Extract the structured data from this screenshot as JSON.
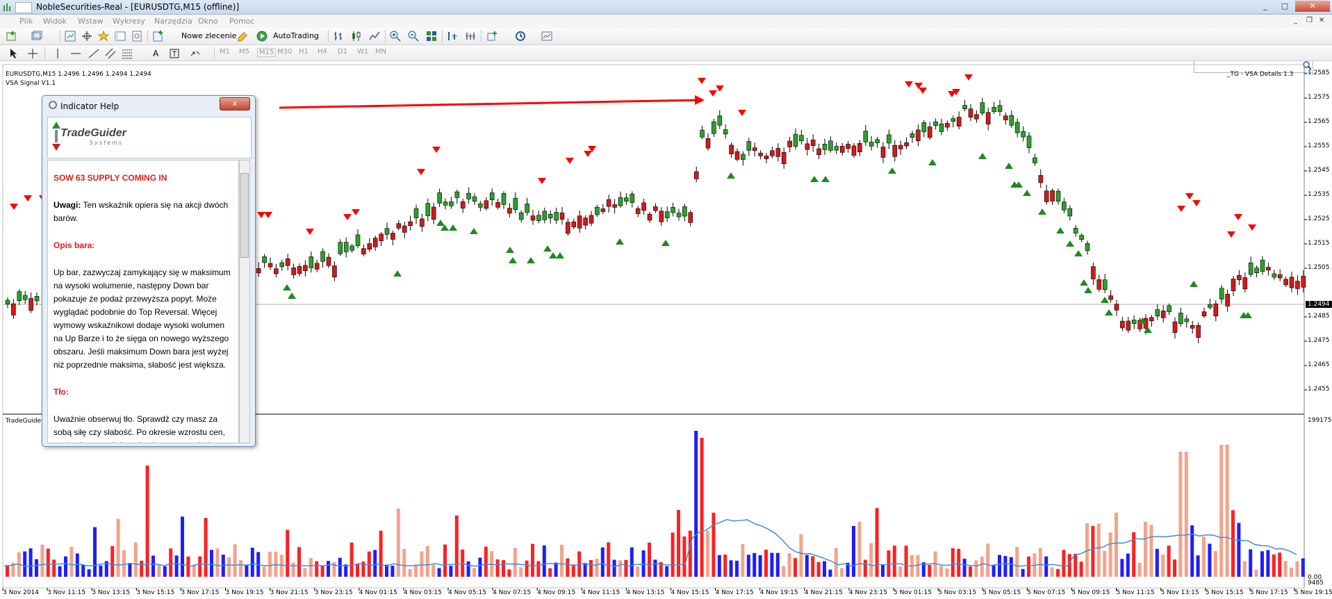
{
  "window": {
    "title": "NobleSecurities-Real - [EURUSDTG,M15 (offline)]"
  },
  "menu": [
    "Plik",
    "Widok",
    "Wstaw",
    "Wykresy",
    "Narzędzia",
    "Okno",
    "Pomoc"
  ],
  "toolbar": {
    "new_order_label": "Nowe zlecenie",
    "autotrading_label": "AutoTrading"
  },
  "timeframes": [
    "M1",
    "M5",
    "M15",
    "M30",
    "H1",
    "H4",
    "D1",
    "W1",
    "MN"
  ],
  "chart": {
    "symbol_info": "EURUSDTG,M15  1.2496 1.2496 1.2494 1.2494",
    "indicator_name": "VSA Signal V1.1",
    "top_right_label": "_TG - VSA Details 1.3",
    "current_price": "1.2494",
    "price_ticks": [
      "1.2585",
      "1.2575",
      "1.2565",
      "1.2555",
      "1.2545",
      "1.2535",
      "1.2525",
      "1.2515",
      "1.2505",
      "1.2494",
      "1.2485",
      "1.2475",
      "1.2465",
      "1.2455"
    ],
    "volume_panel_label": "TradeGuider",
    "volume_max": "199175",
    "volume_min_a": "0.00",
    "volume_min_b": "9485",
    "time_ticks": [
      "3 Nov 2014",
      "3 Nov 11:15",
      "3 Nov 13:15",
      "3 Nov 15:15",
      "3 Nov 17:15",
      "3 Nov 19:15",
      "3 Nov 21:15",
      "3 Nov 23:15",
      "4 Nov 01:15",
      "4 Nov 03:15",
      "4 Nov 05:15",
      "4 Nov 07:15",
      "4 Nov 09:15",
      "4 Nov 11:15",
      "4 Nov 13:15",
      "4 Nov 15:15",
      "4 Nov 17:15",
      "4 Nov 19:15",
      "4 Nov 21:15",
      "4 Nov 23:15",
      "5 Nov 01:15",
      "5 Nov 03:15",
      "5 Nov 05:15",
      "5 Nov 07:15",
      "5 Nov 09:15",
      "5 Nov 11:15",
      "5 Nov 13:15",
      "5 Nov 15:15",
      "5 Nov 17:15",
      "5 Nov 19:15"
    ],
    "colors": {
      "up_candle": "#2ca02c",
      "down_candle": "#d11a1a",
      "up_volume": "#1e1eff",
      "down_volume": "#ff2020",
      "light_volume": "#f4a38c",
      "ma_line": "#3a8fe0",
      "bear_signal": "#ff0000",
      "bull_signal": "#1e8a1e"
    }
  },
  "dialog": {
    "title": "Indicator Help",
    "close_label": "x",
    "logo_name": "TradeGuider",
    "logo_sub": "Systems",
    "heading": "SOW 63 SUPPLY COMING IN",
    "uwagi_label": "Uwagi:",
    "uwagi_text": " Ten wskaźnik opiera się na akcji dwóch barów.",
    "opis_heading": "Opis bara:",
    "opis_text": "Up bar, zazwyczaj zamykający się w maksimum na wysoki wolumenie, następny Down bar pokazuje że podaż przewyższa popyt. Może wyglądać podobnie do Top Reversal. Więcej wymowy wskaźnikowi dodaje wysoki wolumen na Up Barze i to że sięga on nowego wyższego obszaru. Jeśli maksimum Down bara jest wyżej niż poprzednie maksima, słabość jest większa.",
    "tlo_heading": "Tło:",
    "tlo_text": "Uważnie obserwuj tło. Sprawdź czy masz za sobą siłę czy słabość. Po okresie wzrostu cen, może się zacząć dystrybucja za strony jednego"
  }
}
